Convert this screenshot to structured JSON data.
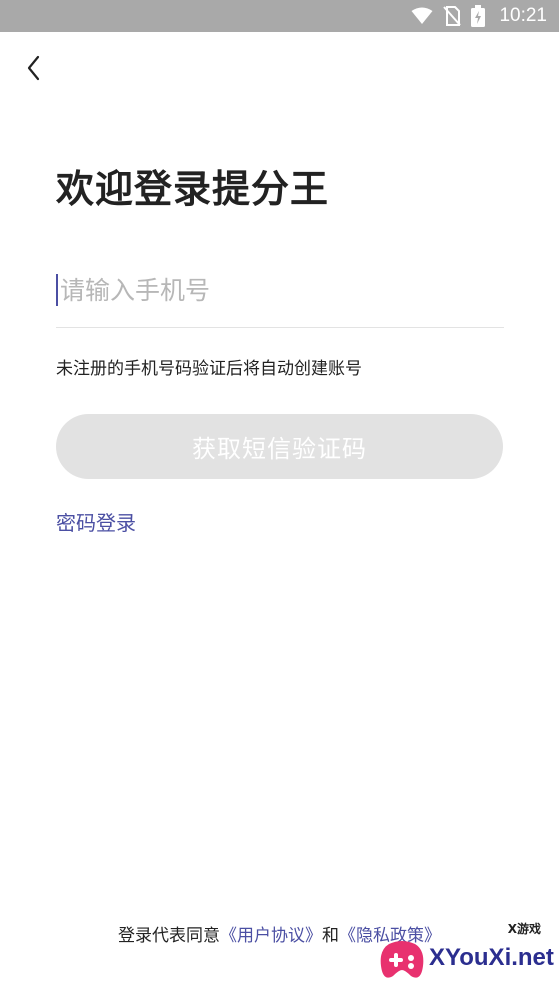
{
  "status_bar": {
    "time": "10:21",
    "icons": [
      "wifi-icon",
      "no-sim-icon",
      "battery-charging-icon"
    ],
    "background": "#a9a9a9"
  },
  "header": {
    "back_icon": "chevron-left-icon"
  },
  "main": {
    "title": "欢迎登录提分王",
    "phone_placeholder": "请输入手机号",
    "phone_value": "",
    "hint": "未注册的手机号码验证后将自动创建账号",
    "sms_button_label": "获取短信验证码",
    "password_login_label": "密码登录"
  },
  "footer": {
    "prefix": "登录代表同意",
    "user_agreement": "《用户协议》",
    "and": "和",
    "privacy_policy": "《隐私政策》"
  },
  "watermark": {
    "small_text": "X游戏",
    "brand_text": "XYouXi.net"
  },
  "colors": {
    "accent": "#4b4fa3",
    "button_disabled": "#e2e2e2",
    "divider": "#e3e3e3"
  }
}
